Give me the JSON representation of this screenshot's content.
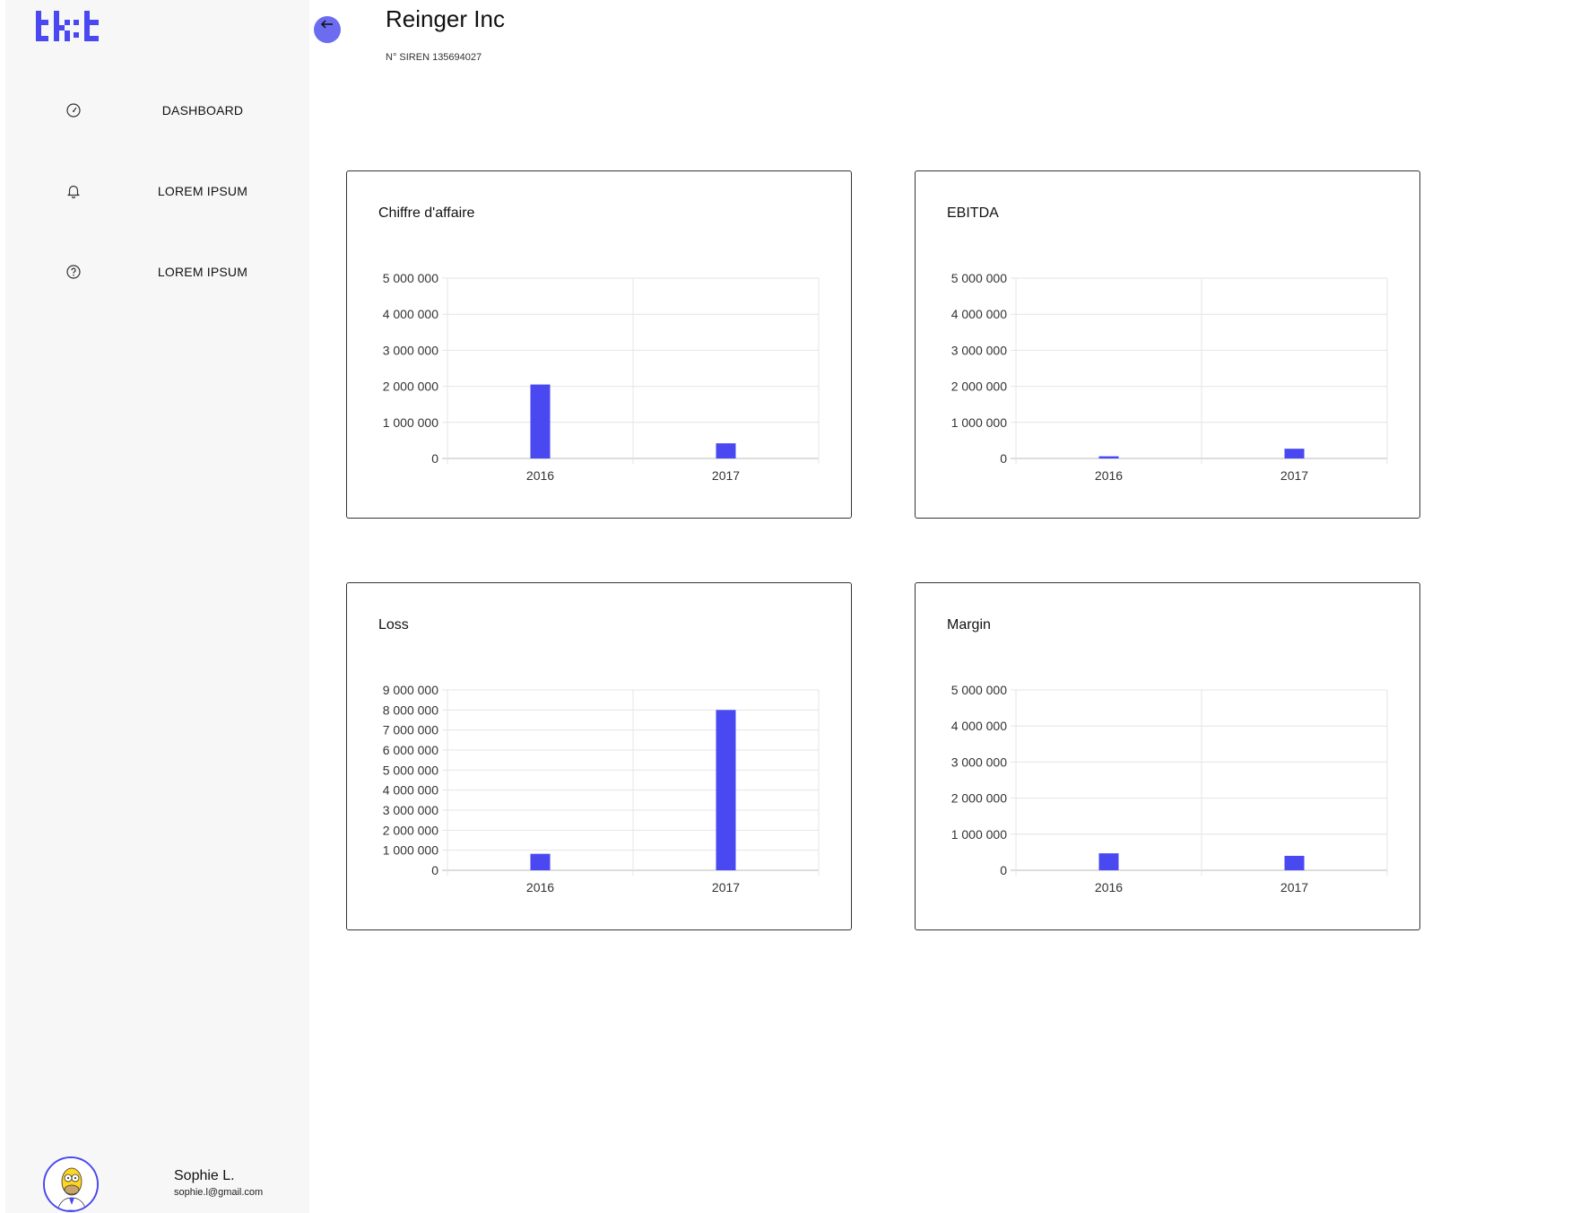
{
  "app": {
    "logo_text": "tk:t",
    "accent_color": "#4a48f0"
  },
  "sidebar": {
    "items": [
      {
        "label": "DASHBOARD",
        "icon": "gauge-icon"
      },
      {
        "label": "LOREM IPSUM",
        "icon": "bell-icon"
      },
      {
        "label": "LOREM IPSUM",
        "icon": "help-circle-icon"
      }
    ]
  },
  "user": {
    "name": "Sophie L.",
    "email": "sophie.l@gmail.com"
  },
  "header": {
    "back_icon": "arrow-left-icon",
    "company_name": "Reinger Inc",
    "siren": "N° SIREN 135694027"
  },
  "chart_data": [
    {
      "type": "bar",
      "title": "Chiffre d'affaire",
      "categories": [
        "2016",
        "2017"
      ],
      "values": [
        2050000,
        420000
      ],
      "ylim": [
        0,
        5000000
      ],
      "yticks": [
        0,
        1000000,
        2000000,
        3000000,
        4000000,
        5000000
      ],
      "ytick_labels": [
        "0",
        "1 000 000",
        "2 000 000",
        "3 000 000",
        "4 000 000",
        "5 000 000"
      ],
      "bar_color": "#4a48f0",
      "grid": true
    },
    {
      "type": "bar",
      "title": "EBITDA",
      "categories": [
        "2016",
        "2017"
      ],
      "values": [
        60000,
        270000
      ],
      "ylim": [
        0,
        5000000
      ],
      "yticks": [
        0,
        1000000,
        2000000,
        3000000,
        4000000,
        5000000
      ],
      "ytick_labels": [
        "0",
        "1 000 000",
        "2 000 000",
        "3 000 000",
        "4 000 000",
        "5 000 000"
      ],
      "bar_color": "#4a48f0",
      "grid": true
    },
    {
      "type": "bar",
      "title": "Loss",
      "categories": [
        "2016",
        "2017"
      ],
      "values": [
        820000,
        8000000
      ],
      "ylim": [
        0,
        9000000
      ],
      "yticks": [
        0,
        1000000,
        2000000,
        3000000,
        4000000,
        5000000,
        6000000,
        7000000,
        8000000,
        9000000
      ],
      "ytick_labels": [
        "0",
        "1 000 000",
        "2 000 000",
        "3 000 000",
        "4 000 000",
        "5 000 000",
        "6 000 000",
        "7 000 000",
        "8 000 000",
        "9 000 000"
      ],
      "bar_color": "#4a48f0",
      "grid": true
    },
    {
      "type": "bar",
      "title": "Margin",
      "categories": [
        "2016",
        "2017"
      ],
      "values": [
        470000,
        400000
      ],
      "ylim": [
        0,
        5000000
      ],
      "yticks": [
        0,
        1000000,
        2000000,
        3000000,
        4000000,
        5000000
      ],
      "ytick_labels": [
        "0",
        "1 000 000",
        "2 000 000",
        "3 000 000",
        "4 000 000",
        "5 000 000"
      ],
      "bar_color": "#4a48f0",
      "grid": true
    }
  ]
}
